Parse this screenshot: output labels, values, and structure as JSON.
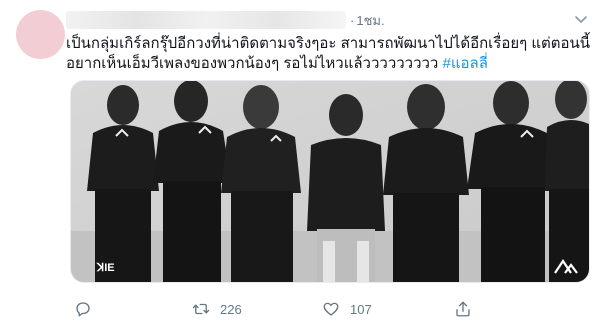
{
  "tweet": {
    "time": "1ชม.",
    "separator": "·",
    "text_line1": "เป็นกลุ่มเกิร์ลกรุ๊ปอีกวงที่น่าติดตามจริงๆอะ สามารถพัฒนาไปได้อีกเรื่อยๆ แต่ตอนนี้",
    "text_line2": "อยากเห็นเอ็มวีเพลงของพวกน้องๆ รอไม่ไหวแล้ววววววววว ",
    "hashtag": "#แอลลี่",
    "media_logo_left": "ꓘIE"
  },
  "actions": {
    "reply_icon": "reply-icon",
    "retweet_icon": "retweet-icon",
    "retweet_count": "226",
    "like_icon": "heart-icon",
    "like_count": "107",
    "share_icon": "share-icon"
  },
  "colors": {
    "avatar": "#f3cdd4",
    "hashtag": "#1b95e0",
    "muted": "#657786"
  }
}
